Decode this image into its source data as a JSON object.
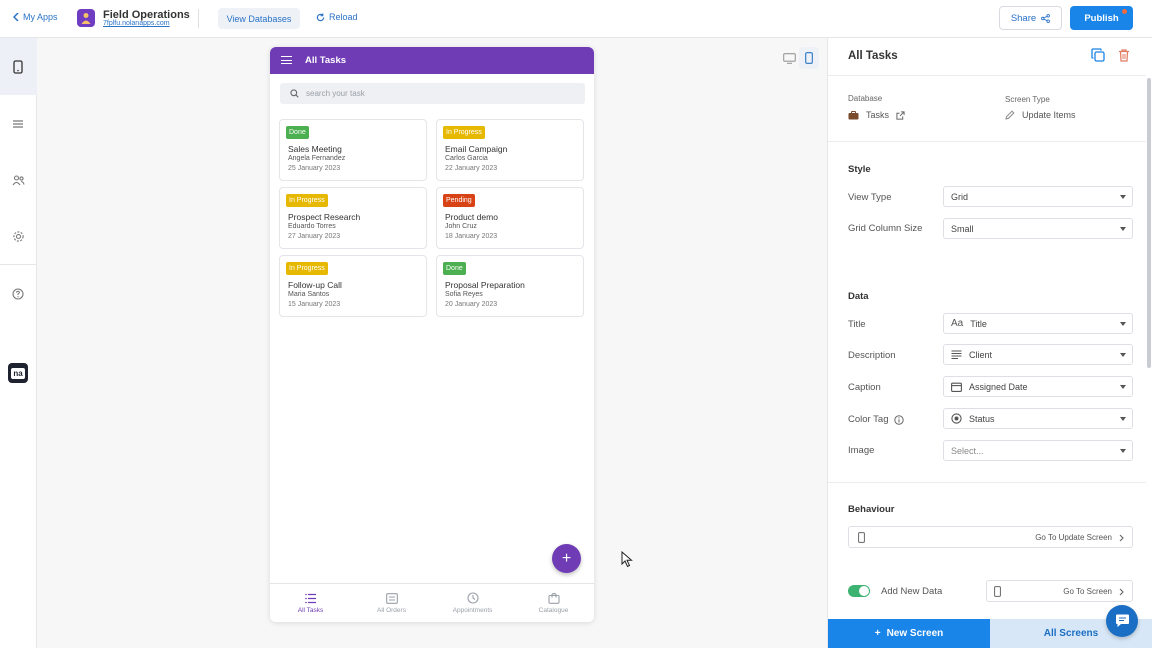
{
  "topbar": {
    "back_label": "My Apps",
    "app_title": "Field Operations",
    "app_url": "7fplfu.nolanapps.com",
    "view_databases_label": "View Databases",
    "reload_label": "Reload",
    "share_label": "Share",
    "publish_label": "Publish"
  },
  "sidebar": {
    "items": [
      "phone-icon",
      "list-icon",
      "users-icon",
      "gear-icon",
      "help-icon"
    ],
    "logo_text": "na"
  },
  "phone": {
    "header_title": "All Tasks",
    "search_placeholder": "search your task",
    "cards": [
      {
        "status": "Done",
        "status_color": "#4caf50",
        "title": "Sales Meeting",
        "client": "Angela Fernandez",
        "date": "25 January 2023"
      },
      {
        "status": "In Progress",
        "status_color": "#e6b800",
        "title": "Email Campaign",
        "client": "Carlos Garcia",
        "date": "22 January 2023"
      },
      {
        "status": "In Progress",
        "status_color": "#e6b800",
        "title": "Prospect Research",
        "client": "Eduardo Torres",
        "date": "27 January 2023"
      },
      {
        "status": "Pending",
        "status_color": "#d84315",
        "title": "Product demo",
        "client": "John Cruz",
        "date": "18 January 2023"
      },
      {
        "status": "In Progress",
        "status_color": "#e6b800",
        "title": "Follow-up Call",
        "client": "Maria Santos",
        "date": "15 January 2023"
      },
      {
        "status": "Done",
        "status_color": "#4caf50",
        "title": "Proposal Preparation",
        "client": "Sofia Reyes",
        "date": "20 January 2023"
      }
    ],
    "fab_label": "+",
    "tabs": [
      {
        "label": "All Tasks",
        "icon": "list-icon",
        "active": true
      },
      {
        "label": "All Orders",
        "icon": "list-icon",
        "active": false
      },
      {
        "label": "Appointments",
        "icon": "clock-icon",
        "active": false
      },
      {
        "label": "Catalogue",
        "icon": "bag-icon",
        "active": false
      }
    ]
  },
  "panel": {
    "title": "All Tasks",
    "database_label": "Database",
    "database_value": "Tasks",
    "screen_type_label": "Screen Type",
    "screen_type_value": "Update Items",
    "style_section": "Style",
    "view_type_label": "View Type",
    "view_type_value": "Grid",
    "grid_col_label": "Grid Column Size",
    "grid_col_value": "Small",
    "data_section": "Data",
    "title_label": "Title",
    "title_icon_text": "Aa",
    "title_value": "Title",
    "description_label": "Description",
    "description_value": "Client",
    "caption_label": "Caption",
    "caption_value": "Assigned Date",
    "color_tag_label": "Color Tag",
    "color_tag_value": "Status",
    "image_label": "Image",
    "image_value": "Select...",
    "behaviour_section": "Behaviour",
    "go_update_label": "Go To Update Screen",
    "add_new_data_label": "Add New Data",
    "go_screen_label": "Go To Screen",
    "add_new_data_enabled": true
  },
  "footer": {
    "new_screen_label": "New Screen",
    "new_screen_plus": "+",
    "all_screens_label": "All Screens"
  },
  "colors": {
    "brand_purple": "#6f3cb5",
    "primary_blue": "#1a85e8",
    "toggle_green": "#3cb371"
  }
}
